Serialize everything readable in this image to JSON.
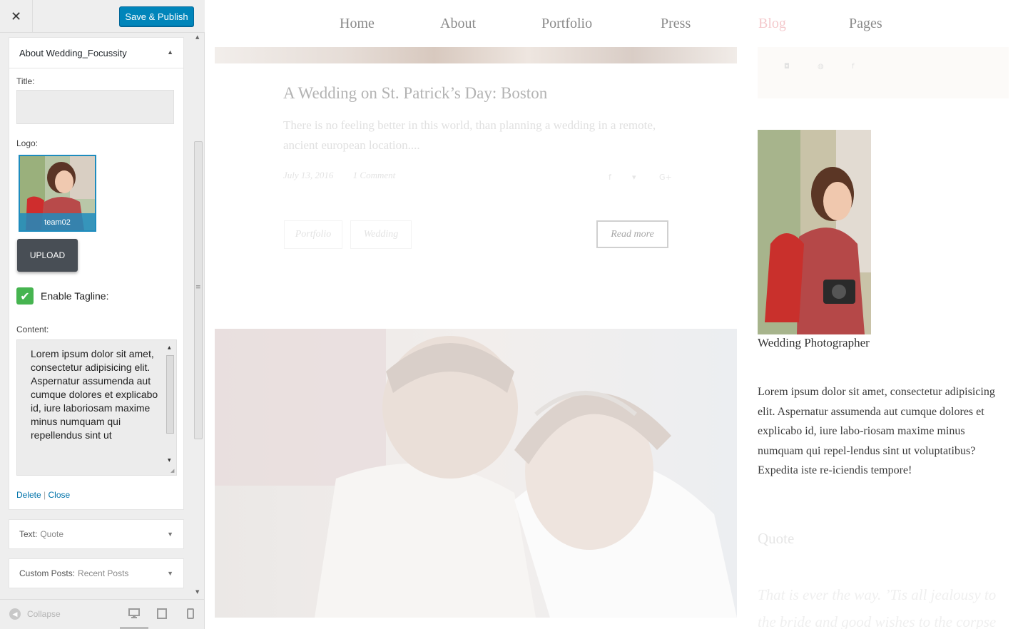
{
  "customizer": {
    "close_icon": "close-icon",
    "publish_label": "Save & Publish",
    "about_widget": {
      "title": "About Wedding_Focussity",
      "title_label": "Title:",
      "title_value": "",
      "logo_label": "Logo:",
      "logo_caption": "team02",
      "upload_label": "UPLOAD",
      "tagline_checked": true,
      "tagline_label": "Enable Tagline:",
      "content_label": "Content:",
      "content_value": "Lorem ipsum dolor sit amet, consectetur adipisicing elit. Aspernatur assumenda aut cumque dolores et explicabo id, iure laboriosam maxime minus numquam qui repellendus sint ut",
      "delete_label": "Delete",
      "separator": "|",
      "close_label": "Close"
    },
    "quote_widget": {
      "type": "Text:",
      "name": "Quote"
    },
    "recent_widget": {
      "type": "Custom Posts:",
      "name": "Recent Posts"
    },
    "footer": {
      "collapse_label": "Collapse",
      "devices": [
        "desktop",
        "tablet",
        "mobile"
      ],
      "active_device": "desktop"
    }
  },
  "preview": {
    "nav": [
      "Home",
      "About",
      "Portfolio",
      "Press",
      "Blog",
      "Pages"
    ],
    "active_nav": "Blog",
    "post": {
      "title": "A Wedding on St. Patrick’s Day: Boston",
      "excerpt": "There is no feeling better in this world, than planning a wedding in a remote, ancient european location....",
      "date": "July 13, 2016",
      "comments": "1 Comment",
      "tags": [
        "Portfolio",
        "Wedding"
      ],
      "read_more": "Read more"
    },
    "sidebar": {
      "social_icons": [
        "instagram-icon",
        "pinterest-icon",
        "facebook-icon"
      ],
      "photographer_caption": "Wedding Photographer",
      "about_text": "Lorem ipsum dolor sit amet, consectetur adipisicing elit. Aspernatur assumenda aut cumque dolores et explicabo id, iure labo-riosam maxime minus numquam qui repel-lendus sint ut voluptatibus? Expedita iste re-iciendis tempore!",
      "quote_heading": "Quote",
      "quote_text": "That is ever the way. ’Tis all jealousy to the bride and good wishes to the corpse"
    }
  },
  "colors": {
    "publish_blue": "#0085ba",
    "check_green": "#46b450",
    "link_blue": "#0073aa",
    "active_nav_pink": "#f4c9cc"
  }
}
